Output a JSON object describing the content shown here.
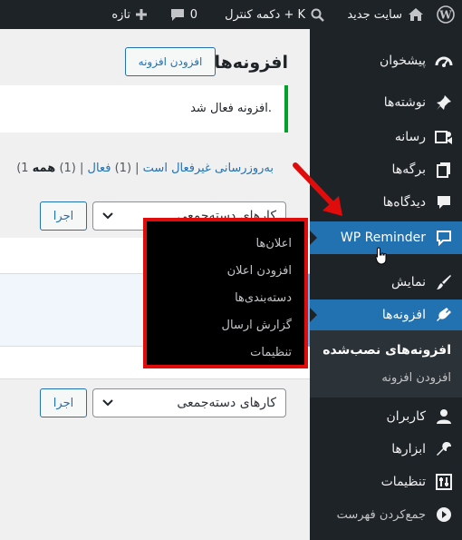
{
  "adminbar": {
    "wp_logo": "wordpress-logo-icon",
    "site_name": "سایت جدید",
    "command": "دکمه کنترل + K",
    "comments_count": "0",
    "new_label": "تازه"
  },
  "sidebar": {
    "dashboard": "پیشخوان",
    "posts": "نوشته‌ها",
    "media": "رسانه",
    "pages": "برگه‌ها",
    "comments": "دیدگاه‌ها",
    "wp_reminder": "WP Reminder",
    "appearance": "نمایش",
    "plugins": "افزونه‌ها",
    "plugins_sub": {
      "installed": "افزونه‌های نصب‌شده",
      "add_new": "افزودن افزونه"
    },
    "users": "کاربران",
    "tools": "ابزارها",
    "settings": "تنظیمات",
    "collapse": "جمع‌کردن فهرست"
  },
  "flyout": {
    "items": [
      "اعلان‌ها",
      "افزودن اعلان",
      "دسته‌بندی‌ها",
      "گزارش ارسال",
      "تنظیمات"
    ]
  },
  "main": {
    "title": "افزونه‌ها",
    "add_button": "افزودن افزونه",
    "notice": "افزونه فعال شد.",
    "filters": {
      "all": "همه",
      "all_count": "(1)",
      "active": "فعال",
      "active_count": "(1)",
      "auto_update_disabled": "به‌روزرسانی غیرفعال است",
      "auto_update_count": "(1"
    },
    "bulk_actions_top": "کارهای دسته‌جمعی",
    "apply_top": "اجرا",
    "bulk_actions_bottom": "کارهای دسته‌جمعی",
    "apply_bottom": "اجرا"
  }
}
